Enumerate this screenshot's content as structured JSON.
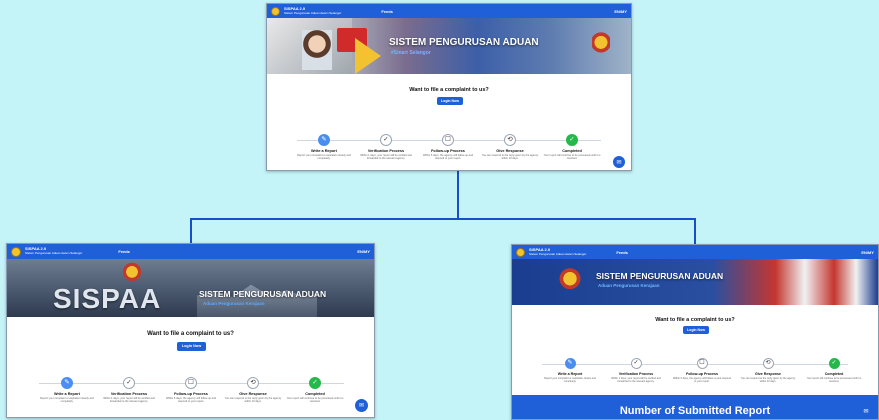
{
  "screens": {
    "top": {
      "brand_title": "SISPAA 2.0",
      "brand_sub": "Sistem Pengurusan Aduan Awam Selangor",
      "nav_link": "Feeds",
      "lang": "EN/MY",
      "banner_title": "SISTEM PENGURUSAN ADUAN",
      "banner_sub": "#Smart Selangor",
      "cta_title": "Want to file a complaint to us?",
      "login_label": "Login Now"
    },
    "left": {
      "brand_title": "SISPAA 2.0",
      "brand_sub": "Sistem Pengurusan Aduan Awam Selangor",
      "nav_link": "Feeds",
      "lang": "EN/MY",
      "banner_big": "SISPAA",
      "banner_title": "SISTEM PENGURUSAN ADUAN",
      "banner_sub": "Aduan Pengurusan Kerajaan",
      "cta_title": "Want to file a complaint to us?",
      "login_label": "Login Now"
    },
    "right": {
      "brand_title": "SISPAA 2.0",
      "brand_sub": "Sistem Pengurusan Aduan Awam Selangor",
      "nav_link": "Feeds",
      "lang": "EN/MY",
      "banner_title": "SISTEM PENGURUSAN ADUAN",
      "banner_sub": "Aduan Pengurusan Kerajaan",
      "cta_title": "Want to file a complaint to us?",
      "login_label": "Login Now",
      "stats_title": "Number of Submitted Report"
    }
  },
  "steps": [
    {
      "title": "Write a Report",
      "desc": "Report your complaint or aspiration clearly and completely.",
      "icon": "pencil-icon",
      "style": "blue"
    },
    {
      "title": "Verification Process",
      "desc": "Within 1 days, your report will be verified and forwarded to the relevant agency.",
      "icon": "check-circle-icon",
      "style": "plain"
    },
    {
      "title": "Follow-up Process",
      "desc": "Within 5 days, the agency will follow up and respond to your report.",
      "icon": "chat-icon",
      "style": "plain"
    },
    {
      "title": "Give Response",
      "desc": "You can respond to the reply given by the agency within 10 days.",
      "icon": "reply-icon",
      "style": "plain"
    },
    {
      "title": "Completed",
      "desc": "Your report will continue to be processed until it is resolved.",
      "icon": "check-icon",
      "style": "green"
    }
  ],
  "colors": {
    "nav": "#1f5fd8",
    "accent_blue": "#4a8ff0",
    "done_green": "#25b84a",
    "connector": "#1650c8",
    "background": "#c4f4f8"
  }
}
